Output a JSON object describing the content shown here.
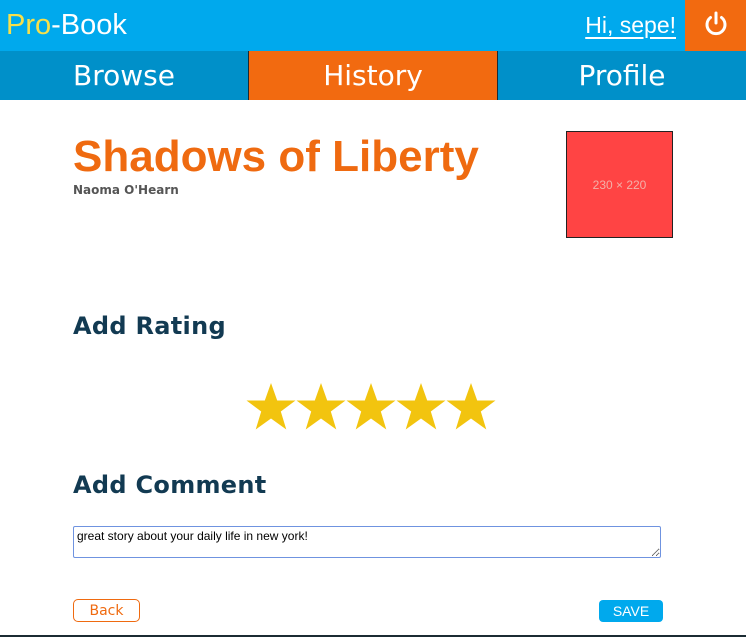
{
  "header": {
    "logo_pro": "Pro",
    "logo_book": "-Book",
    "greeting": "Hi, sepe!",
    "logout_icon": "power-icon",
    "colors": {
      "bar": "#00a9ed",
      "accent": "#f26a10",
      "logo_pro": "#f7e04b"
    }
  },
  "nav": {
    "tabs": [
      {
        "label": "Browse",
        "active": false
      },
      {
        "label": "History",
        "active": true
      },
      {
        "label": "Profile",
        "active": false
      }
    ]
  },
  "book": {
    "title": "Shadows of Liberty",
    "author": "Naoma O'Hearn",
    "cover_placeholder": "230 × 220"
  },
  "rating": {
    "heading": "Add Rating",
    "value": 5,
    "max": 5,
    "star_color": "#f2c40f"
  },
  "comment": {
    "heading": "Add Comment",
    "value": "great story about your daily life in new york!"
  },
  "actions": {
    "back_label": "Back",
    "save_label": "SAVE"
  }
}
